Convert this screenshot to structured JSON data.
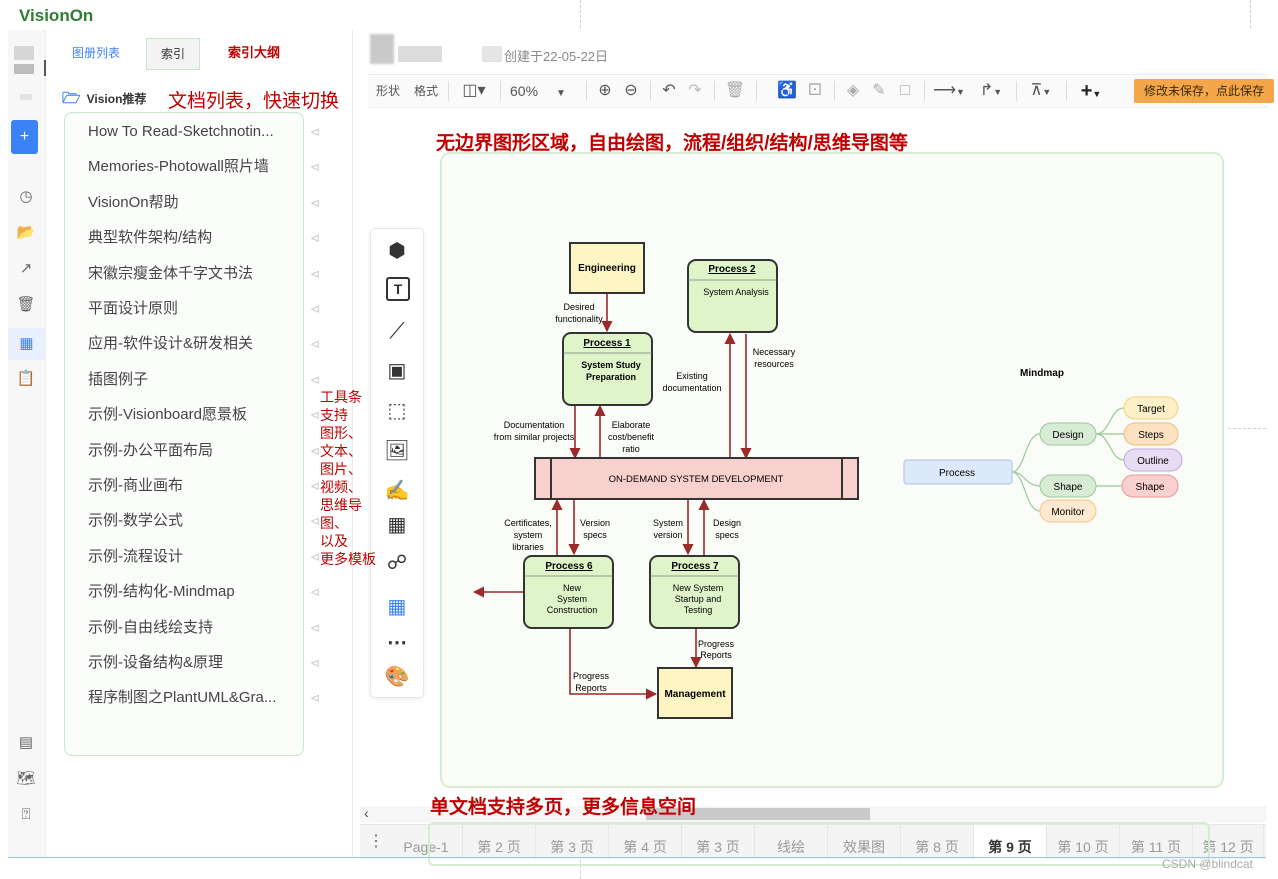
{
  "brand": "VisionOn",
  "doc_panel": {
    "tabs": [
      "图册列表",
      "索引",
      "索引大纲"
    ],
    "folder": "Vision推荐",
    "annotation": "文档列表，快速切换",
    "items": [
      "How To Read-Sketchnotin...",
      "Memories-Photowall照片墙",
      "VisionOn帮助",
      "典型软件架构/结构",
      "宋徽宗瘦金体千字文书法",
      "平面设计原则",
      "应用-软件设计&研发相关",
      "插图例子",
      "示例-Visionboard愿景板",
      "示例-办公平面布局",
      "示例-商业画布",
      "示例-数学公式",
      "示例-流程设计",
      "示例-结构化-Mindmap",
      "示例-自由线绘支持",
      "示例-设备结构&原理",
      "程序制图之PlantUML&Gra..."
    ]
  },
  "header": {
    "created": "创建于22-05-22日"
  },
  "toolbar": {
    "shape_label": "形状",
    "format_label": "格式",
    "zoom": "60%",
    "save_label": "修改未保存，点此保存"
  },
  "annotations": {
    "canvas": "无边界图形区域，自由绘图，流程/组织/结构/思维导图等",
    "tools": [
      "工具条",
      "支持",
      "图形、",
      "文本、",
      "图片、",
      "视频、",
      "思维导图、",
      "以及",
      "更多模板"
    ],
    "pages": "单文档支持多页，更多信息空间"
  },
  "diagram": {
    "engineering": "Engineering",
    "process2_title": "Process 2",
    "process2_body": "System Analysis",
    "process1_title": "Process 1",
    "process1_body": [
      "System Study",
      "Preparation"
    ],
    "desired": [
      "Desired",
      "functionality"
    ],
    "existing": [
      "Existing",
      "documentation"
    ],
    "necessary": [
      "Necessary",
      "resources"
    ],
    "documentation": [
      "Documentation",
      "from similar projects"
    ],
    "elaborate": [
      "Elaborate",
      "cost/benefit",
      "ratio"
    ],
    "central": "ON-DEMAND SYSTEM DEVELOPMENT",
    "certificates": [
      "Certificates,",
      "system",
      "libraries"
    ],
    "version_specs": [
      "Version",
      "specs"
    ],
    "system_version": [
      "System",
      "version"
    ],
    "design_specs": [
      "Design",
      "specs"
    ],
    "process6_title": "Process 6",
    "process6_body": [
      "New",
      "System",
      "Construction"
    ],
    "process7_title": "Process 7",
    "process7_body": [
      "New System",
      "Startup and",
      "Testing"
    ],
    "progress_a": [
      "Progress",
      "Reports"
    ],
    "progress_b": [
      "Progress",
      "Reports"
    ],
    "management": "Management"
  },
  "mindmap": {
    "title": "Mindmap",
    "root": "Process",
    "nodes": [
      "Design",
      "Shape",
      "Monitor"
    ],
    "leaves": [
      "Target",
      "Steps",
      "Outline",
      "Shape"
    ],
    "colors": {
      "root": "#dce9fb",
      "branch": "#d8ecd5",
      "monitor": "#fde9cf",
      "target": "#fdf0c9",
      "steps": "#fde2c2",
      "outline": "#e8dcf2",
      "shape_leaf": "#f8d0cf"
    }
  },
  "pages": {
    "tabs": [
      "Page-1",
      "第 2 页",
      "第 3 页",
      "第 4 页",
      "第 3 页",
      "线绘",
      "效果图",
      "第 8 页",
      "第 9 页",
      "第 10 页",
      "第 11 页",
      "第 12 页"
    ],
    "active_index": 8
  },
  "watermark": "CSDN @blindcat",
  "colors": {
    "accent": "#3b82f6",
    "annotation": "#c00000",
    "save": "#f5a64a",
    "process_fill": "#dff5c9",
    "central_fill": "#f8d1cf",
    "arrow": "#9b2a2a"
  }
}
